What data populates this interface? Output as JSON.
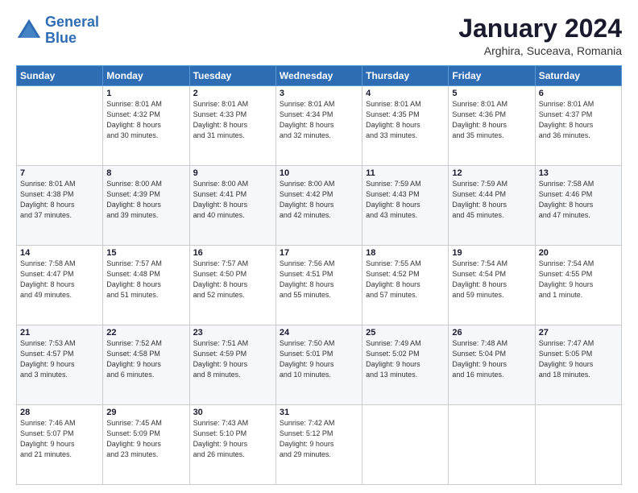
{
  "logo": {
    "line1": "General",
    "line2": "Blue"
  },
  "title": "January 2024",
  "subtitle": "Arghira, Suceava, Romania",
  "weekdays": [
    "Sunday",
    "Monday",
    "Tuesday",
    "Wednesday",
    "Thursday",
    "Friday",
    "Saturday"
  ],
  "weeks": [
    [
      {
        "day": "",
        "sunrise": "",
        "sunset": "",
        "daylight": ""
      },
      {
        "day": "1",
        "sunrise": "Sunrise: 8:01 AM",
        "sunset": "Sunset: 4:32 PM",
        "daylight": "Daylight: 8 hours and 30 minutes."
      },
      {
        "day": "2",
        "sunrise": "Sunrise: 8:01 AM",
        "sunset": "Sunset: 4:33 PM",
        "daylight": "Daylight: 8 hours and 31 minutes."
      },
      {
        "day": "3",
        "sunrise": "Sunrise: 8:01 AM",
        "sunset": "Sunset: 4:34 PM",
        "daylight": "Daylight: 8 hours and 32 minutes."
      },
      {
        "day": "4",
        "sunrise": "Sunrise: 8:01 AM",
        "sunset": "Sunset: 4:35 PM",
        "daylight": "Daylight: 8 hours and 33 minutes."
      },
      {
        "day": "5",
        "sunrise": "Sunrise: 8:01 AM",
        "sunset": "Sunset: 4:36 PM",
        "daylight": "Daylight: 8 hours and 35 minutes."
      },
      {
        "day": "6",
        "sunrise": "Sunrise: 8:01 AM",
        "sunset": "Sunset: 4:37 PM",
        "daylight": "Daylight: 8 hours and 36 minutes."
      }
    ],
    [
      {
        "day": "7",
        "sunrise": "Sunrise: 8:01 AM",
        "sunset": "Sunset: 4:38 PM",
        "daylight": "Daylight: 8 hours and 37 minutes."
      },
      {
        "day": "8",
        "sunrise": "Sunrise: 8:00 AM",
        "sunset": "Sunset: 4:39 PM",
        "daylight": "Daylight: 8 hours and 39 minutes."
      },
      {
        "day": "9",
        "sunrise": "Sunrise: 8:00 AM",
        "sunset": "Sunset: 4:41 PM",
        "daylight": "Daylight: 8 hours and 40 minutes."
      },
      {
        "day": "10",
        "sunrise": "Sunrise: 8:00 AM",
        "sunset": "Sunset: 4:42 PM",
        "daylight": "Daylight: 8 hours and 42 minutes."
      },
      {
        "day": "11",
        "sunrise": "Sunrise: 7:59 AM",
        "sunset": "Sunset: 4:43 PM",
        "daylight": "Daylight: 8 hours and 43 minutes."
      },
      {
        "day": "12",
        "sunrise": "Sunrise: 7:59 AM",
        "sunset": "Sunset: 4:44 PM",
        "daylight": "Daylight: 8 hours and 45 minutes."
      },
      {
        "day": "13",
        "sunrise": "Sunrise: 7:58 AM",
        "sunset": "Sunset: 4:46 PM",
        "daylight": "Daylight: 8 hours and 47 minutes."
      }
    ],
    [
      {
        "day": "14",
        "sunrise": "Sunrise: 7:58 AM",
        "sunset": "Sunset: 4:47 PM",
        "daylight": "Daylight: 8 hours and 49 minutes."
      },
      {
        "day": "15",
        "sunrise": "Sunrise: 7:57 AM",
        "sunset": "Sunset: 4:48 PM",
        "daylight": "Daylight: 8 hours and 51 minutes."
      },
      {
        "day": "16",
        "sunrise": "Sunrise: 7:57 AM",
        "sunset": "Sunset: 4:50 PM",
        "daylight": "Daylight: 8 hours and 52 minutes."
      },
      {
        "day": "17",
        "sunrise": "Sunrise: 7:56 AM",
        "sunset": "Sunset: 4:51 PM",
        "daylight": "Daylight: 8 hours and 55 minutes."
      },
      {
        "day": "18",
        "sunrise": "Sunrise: 7:55 AM",
        "sunset": "Sunset: 4:52 PM",
        "daylight": "Daylight: 8 hours and 57 minutes."
      },
      {
        "day": "19",
        "sunrise": "Sunrise: 7:54 AM",
        "sunset": "Sunset: 4:54 PM",
        "daylight": "Daylight: 8 hours and 59 minutes."
      },
      {
        "day": "20",
        "sunrise": "Sunrise: 7:54 AM",
        "sunset": "Sunset: 4:55 PM",
        "daylight": "Daylight: 9 hours and 1 minute."
      }
    ],
    [
      {
        "day": "21",
        "sunrise": "Sunrise: 7:53 AM",
        "sunset": "Sunset: 4:57 PM",
        "daylight": "Daylight: 9 hours and 3 minutes."
      },
      {
        "day": "22",
        "sunrise": "Sunrise: 7:52 AM",
        "sunset": "Sunset: 4:58 PM",
        "daylight": "Daylight: 9 hours and 6 minutes."
      },
      {
        "day": "23",
        "sunrise": "Sunrise: 7:51 AM",
        "sunset": "Sunset: 4:59 PM",
        "daylight": "Daylight: 9 hours and 8 minutes."
      },
      {
        "day": "24",
        "sunrise": "Sunrise: 7:50 AM",
        "sunset": "Sunset: 5:01 PM",
        "daylight": "Daylight: 9 hours and 10 minutes."
      },
      {
        "day": "25",
        "sunrise": "Sunrise: 7:49 AM",
        "sunset": "Sunset: 5:02 PM",
        "daylight": "Daylight: 9 hours and 13 minutes."
      },
      {
        "day": "26",
        "sunrise": "Sunrise: 7:48 AM",
        "sunset": "Sunset: 5:04 PM",
        "daylight": "Daylight: 9 hours and 16 minutes."
      },
      {
        "day": "27",
        "sunrise": "Sunrise: 7:47 AM",
        "sunset": "Sunset: 5:05 PM",
        "daylight": "Daylight: 9 hours and 18 minutes."
      }
    ],
    [
      {
        "day": "28",
        "sunrise": "Sunrise: 7:46 AM",
        "sunset": "Sunset: 5:07 PM",
        "daylight": "Daylight: 9 hours and 21 minutes."
      },
      {
        "day": "29",
        "sunrise": "Sunrise: 7:45 AM",
        "sunset": "Sunset: 5:09 PM",
        "daylight": "Daylight: 9 hours and 23 minutes."
      },
      {
        "day": "30",
        "sunrise": "Sunrise: 7:43 AM",
        "sunset": "Sunset: 5:10 PM",
        "daylight": "Daylight: 9 hours and 26 minutes."
      },
      {
        "day": "31",
        "sunrise": "Sunrise: 7:42 AM",
        "sunset": "Sunset: 5:12 PM",
        "daylight": "Daylight: 9 hours and 29 minutes."
      },
      {
        "day": "",
        "sunrise": "",
        "sunset": "",
        "daylight": ""
      },
      {
        "day": "",
        "sunrise": "",
        "sunset": "",
        "daylight": ""
      },
      {
        "day": "",
        "sunrise": "",
        "sunset": "",
        "daylight": ""
      }
    ]
  ]
}
